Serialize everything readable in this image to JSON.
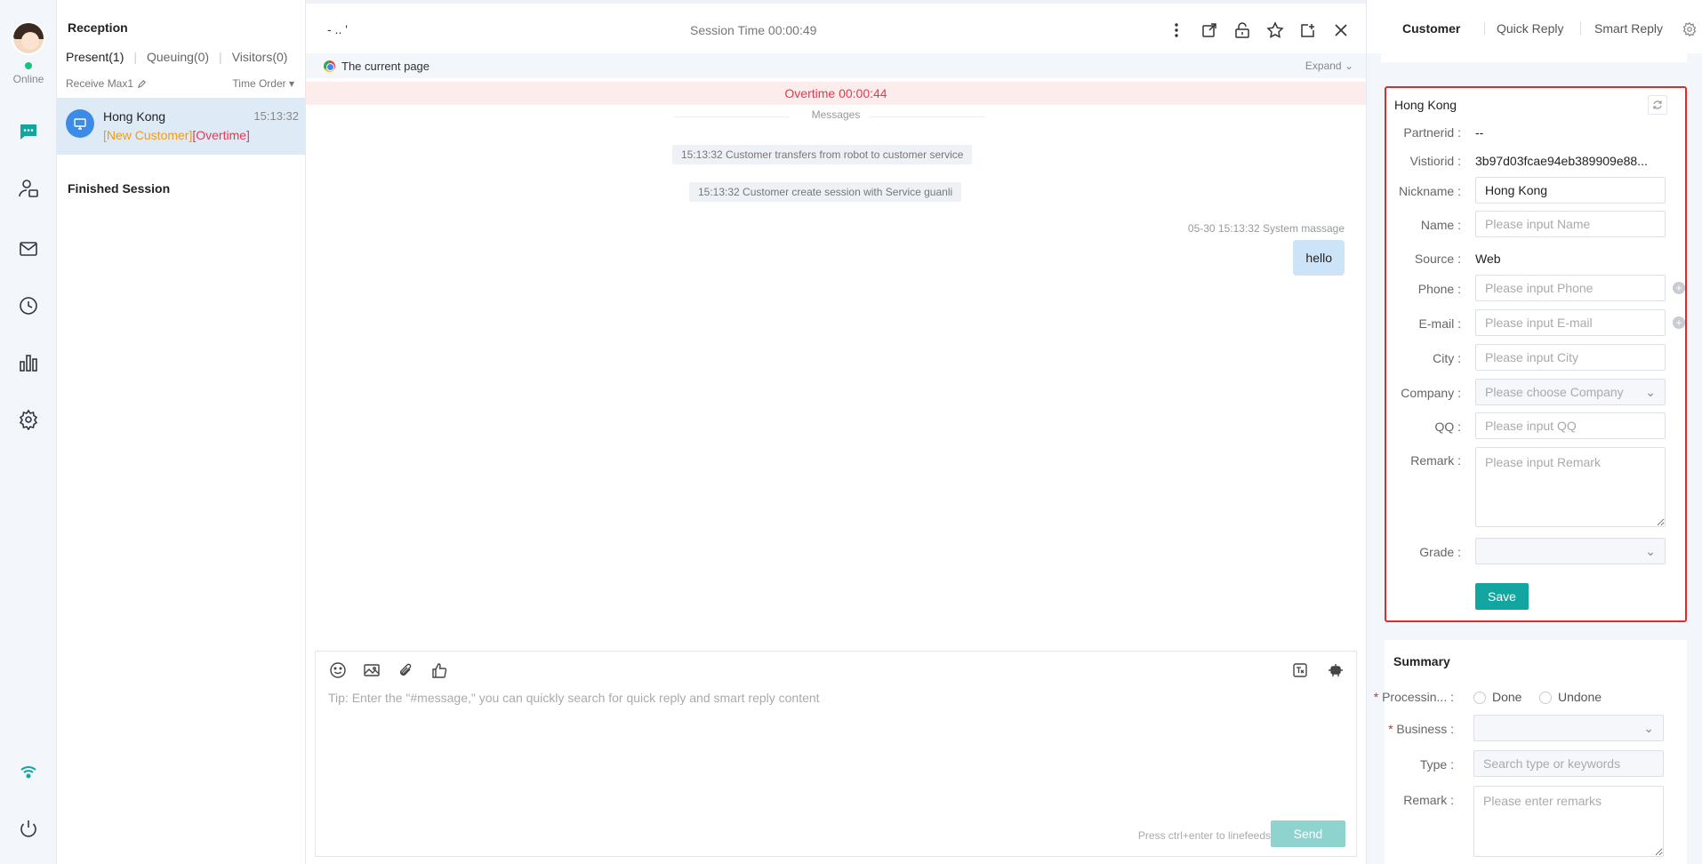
{
  "rail": {
    "status": "Online",
    "items": [
      {
        "name": "chat",
        "icon": "chat-bubble-icon",
        "active": true
      },
      {
        "name": "contacts",
        "icon": "user-card-icon"
      },
      {
        "name": "mail",
        "icon": "mail-icon"
      },
      {
        "name": "history",
        "icon": "clock-icon"
      },
      {
        "name": "stats",
        "icon": "bar-chart-icon"
      },
      {
        "name": "settings",
        "icon": "gear-icon"
      }
    ],
    "bottom": [
      {
        "icon": "wifi-icon"
      },
      {
        "icon": "power-icon"
      }
    ]
  },
  "sessions": {
    "title": "Reception",
    "tabs": [
      "Present(1)",
      "Queuing(0)",
      "Visitors(0)"
    ],
    "receive_max": "Receive Max1",
    "order": "Time Order",
    "item": {
      "name": "Hong Kong",
      "time": "15:13:32",
      "tag_new": "[New Customer]",
      "tag_overtime": "[Overtime]"
    },
    "finished": "Finished Session"
  },
  "chat": {
    "visitor": "- .. '",
    "session_time": "Session Time 00:00:49",
    "current_page": "The current page",
    "expand": "Expand",
    "overtime": "Overtime 00:00:44",
    "divider": "Messages",
    "system_messages": [
      "15:13:32 Customer transfers from robot to customer service",
      "15:13:32 Customer create session with Service guanli"
    ],
    "message_meta": "05-30 15:13:32   System massage",
    "message_text": "hello",
    "composer_placeholder": "Tip: Enter the \"#message,\" you can quickly search for quick reply and smart reply content",
    "hint": "Press ctrl+enter to linefeeds",
    "send": "Send"
  },
  "panel": {
    "tabs": [
      "Customer",
      "Quick Reply",
      "Smart Reply"
    ],
    "card": {
      "title": "Hong Kong",
      "partnerid_label": "Partnerid",
      "partnerid": "--",
      "visitorid_label": "Vistiorid",
      "visitorid": "3b97d03fcae94eb389909e88...",
      "nickname_label": "Nickname",
      "nickname": "Hong Kong",
      "name_label": "Name",
      "name_placeholder": "Please input Name",
      "source_label": "Source",
      "source": "Web",
      "phone_label": "Phone",
      "phone_placeholder": "Please input Phone",
      "email_label": "E-mail",
      "email_placeholder": "Please input E-mail",
      "city_label": "City",
      "city_placeholder": "Please input City",
      "company_label": "Company",
      "company_placeholder": "Please choose Company",
      "qq_label": "QQ",
      "qq_placeholder": "Please input QQ",
      "remark_label": "Remark",
      "remark_placeholder": "Please input Remark",
      "grade_label": "Grade",
      "save": "Save"
    },
    "summary": {
      "title": "Summary",
      "processing_label": "Processin...",
      "done": "Done",
      "undone": "Undone",
      "business_label": "Business",
      "type_label": "Type",
      "type_placeholder": "Search type or keywords",
      "remark_label": "Remark",
      "remark_placeholder": "Please enter remarks"
    }
  },
  "colors": {
    "accent": "#13a5a0",
    "overtime": "#e8384f",
    "new_tag": "#f39c12",
    "highlight_border": "#e52828"
  }
}
